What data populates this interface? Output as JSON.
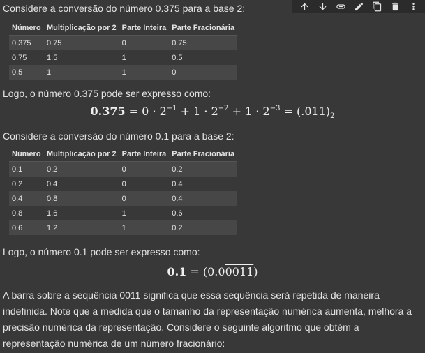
{
  "toolbar": {
    "icons": [
      "arrow-up-icon",
      "arrow-down-icon",
      "link-icon",
      "pencil-icon",
      "copy-icon",
      "trash-icon",
      "more-vert-icon"
    ]
  },
  "intro1": "Considere a conversão do número 0.375 para a base 2:",
  "table_headers": [
    "Número",
    "Multiplicação por 2",
    "Parte Inteira",
    "Parte Fracionária"
  ],
  "table1": [
    [
      "0.375",
      "0.75",
      "0",
      "0.75"
    ],
    [
      "0.75",
      "1.5",
      "1",
      "0.5"
    ],
    [
      "0.5",
      "1",
      "1",
      "0"
    ]
  ],
  "logo1": "Logo, o número 0.375 pode ser expresso como:",
  "eq1": {
    "lhs": "0.375",
    "t1": "0 · 2",
    "e1": "−1",
    "t2": "1 · 2",
    "e2": "−2",
    "t3": "1 · 2",
    "e3": "−3",
    "rhs": "(.011)",
    "base": "2"
  },
  "intro2": "Considere a conversão do número 0.1 para a base 2:",
  "table2": [
    [
      "0.1",
      "0.2",
      "0",
      "0.2"
    ],
    [
      "0.2",
      "0.4",
      "0",
      "0.4"
    ],
    [
      "0.4",
      "0.8",
      "0",
      "0.4"
    ],
    [
      "0.8",
      "1.6",
      "1",
      "0.6"
    ],
    [
      "0.6",
      "1.2",
      "1",
      "0.2"
    ]
  ],
  "logo2": "Logo, o número 0.1 pode ser expresso como:",
  "eq2": {
    "lhs": "0.1",
    "prefix": "(0.0",
    "repeat": "0011",
    "suffix": ")"
  },
  "paragraph": "A barra sobre a sequência 0011 significa que essa sequência será repetida de maneira indefinida. Note que a medida que o tamanho da representação numérica aumenta, melhora a precisão numérica da representação. Considere o seguinte algoritmo que obtém a representação numérica de um número fracionário:"
}
